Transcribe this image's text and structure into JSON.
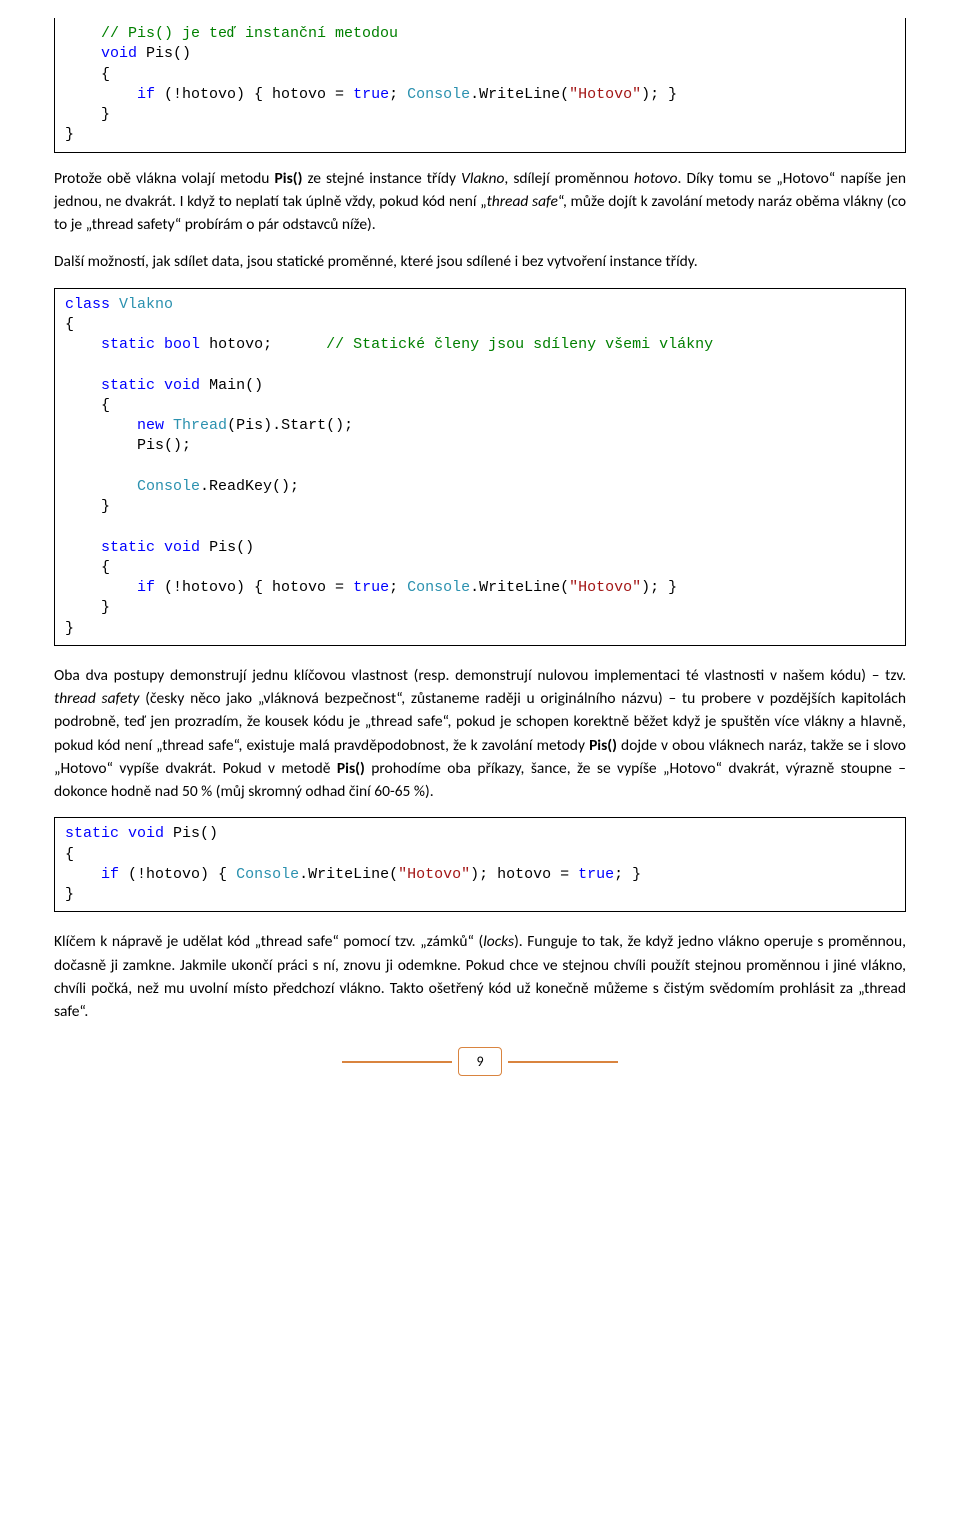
{
  "code1": {
    "l1_cm": "    // Pis() je teď instanční metodou",
    "l2a": "    ",
    "l2b": "void",
    "l2c": " Pis()",
    "l3": "    {",
    "l4a": "        ",
    "l4b": "if",
    "l4c": " (!hotovo) { hotovo = ",
    "l4d": "true",
    "l4e": "; ",
    "l4f": "Console",
    "l4g": ".WriteLine(",
    "l4h": "\"Hotovo\"",
    "l4i": "); }",
    "l5": "    }",
    "l6": "}"
  },
  "p1a": "Protože obě vlákna volají metodu ",
  "p1b": "Pis()",
  "p1c": " ze stejné instance třídy ",
  "p1d": "Vlakno",
  "p1e": ", sdílejí proměnnou ",
  "p1f": "hotovo",
  "p1g": ". Díky tomu se „Hotovo“ napíše jen jednou, ne dvakrát. I když to neplatí tak úplně vždy, pokud kód není „",
  "p1h": "thread safe",
  "p1i": "“, může dojít k zavolání metody naráz oběma vlákny (co to je „thread safety“ probírám o pár odstavců níže).",
  "p2": "Další možností, jak sdílet data, jsou statické proměnné, které jsou sdílené i bez vytvoření instance třídy.",
  "code2": {
    "l1a": "class",
    "l1b": " ",
    "l1c": "Vlakno",
    "l2": "{",
    "l3a": "    ",
    "l3b": "static",
    "l3c": " ",
    "l3d": "bool",
    "l3e": " hotovo;      ",
    "l3f": "// Statické členy jsou sdíleny všemi vlákny",
    "l5a": "    ",
    "l5b": "static",
    "l5c": " ",
    "l5d": "void",
    "l5e": " Main()",
    "l6": "    {",
    "l7a": "        ",
    "l7b": "new",
    "l7c": " ",
    "l7d": "Thread",
    "l7e": "(Pis).Start();",
    "l8": "        Pis();",
    "l10a": "        ",
    "l10b": "Console",
    "l10c": ".ReadKey();",
    "l11": "    }",
    "l13a": "    ",
    "l13b": "static",
    "l13c": " ",
    "l13d": "void",
    "l13e": " Pis()",
    "l14": "    {",
    "l15a": "        ",
    "l15b": "if",
    "l15c": " (!hotovo) { hotovo = ",
    "l15d": "true",
    "l15e": "; ",
    "l15f": "Console",
    "l15g": ".WriteLine(",
    "l15h": "\"Hotovo\"",
    "l15i": "); }",
    "l16": "    }",
    "l17": "}"
  },
  "p3a": "Oba dva postupy demonstrují jednu klíčovou vlastnost (resp. demonstrují nulovou implementaci té vlastnosti v našem kódu) – tzv. ",
  "p3b": "thread safety",
  "p3c": " (česky něco jako „vláknová bezpečnost“, zůstaneme raději u originálního názvu) – tu probere v pozdějších kapitolách podrobně, teď jen prozradím, že kousek kódu je „thread safe“, pokud je schopen korektně běžet když je spuštěn více vlákny a hlavně, pokud kód není „thread safe“, existuje malá pravděpodobnost, že k zavolání metody ",
  "p3d": "Pis()",
  "p3e": " dojde v obou vláknech naráz, takže se i slovo „Hotovo“ vypíše dvakrát. Pokud v metodě ",
  "p3f": "Pis()",
  "p3g": " prohodíme oba příkazy, šance, že se vypíše „Hotovo“ dvakrát, výrazně stoupne – dokonce hodně nad 50 % (můj skromný odhad činí 60-65 %).",
  "code3": {
    "l1a": "static",
    "l1b": " ",
    "l1c": "void",
    "l1d": " Pis()",
    "l2": "{",
    "l3a": "    ",
    "l3b": "if",
    "l3c": " (!hotovo) { ",
    "l3d": "Console",
    "l3e": ".WriteLine(",
    "l3f": "\"Hotovo\"",
    "l3g": "); hotovo = ",
    "l3h": "true",
    "l3i": "; }",
    "l4": "}"
  },
  "p4a": "Klíčem k nápravě je udělat kód „thread safe“ pomocí tzv. „zámků“ (",
  "p4b": "locks",
  "p4c": "). Funguje to tak, že když jedno vlákno operuje s proměnnou, dočasně ji zamkne. Jakmile ukončí práci s ní, znovu ji odemkne. Pokud chce ve stejnou chvíli použít stejnou proměnnou i jiné vlákno, chvíli počká, než mu uvolní místo předchozí vlákno. Takto ošetřený kód už konečně můžeme s čistým svědomím prohlásit za „thread safe“.",
  "pageNum": "9"
}
